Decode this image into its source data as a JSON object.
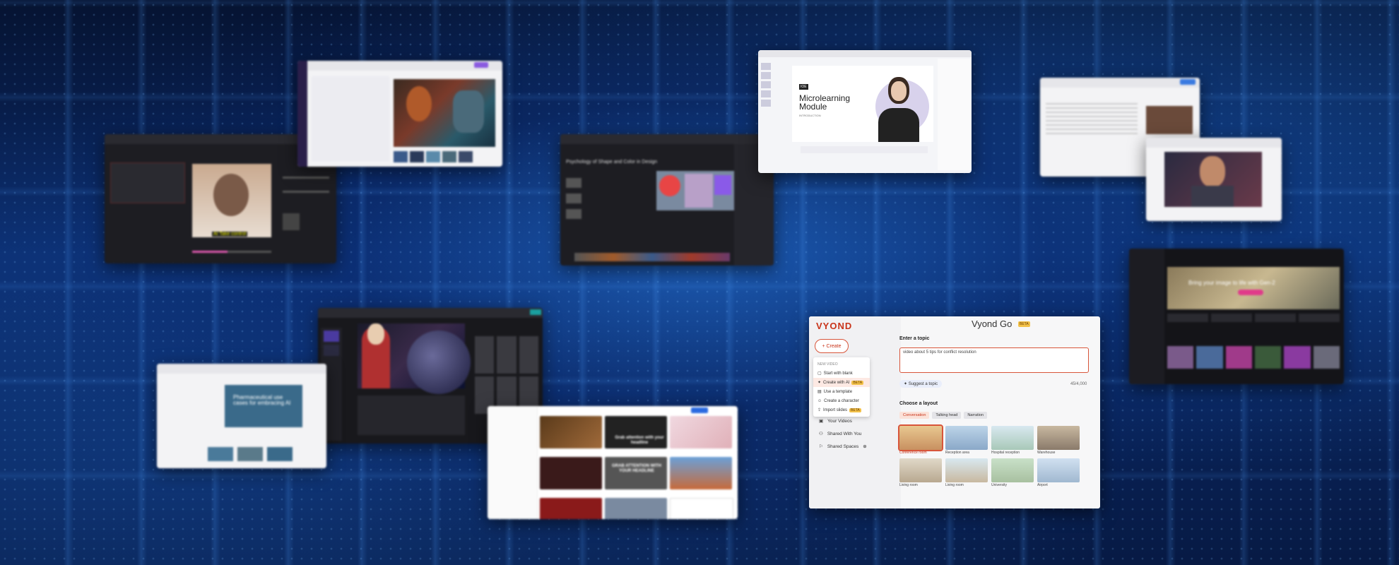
{
  "vyond": {
    "logo": "VYOND",
    "title": "Vyond Go",
    "beta": "BETA",
    "create_button": "+ Create",
    "menu_header": "NEW VIDEO",
    "menu_items": [
      {
        "label": "Start with blank",
        "badge": ""
      },
      {
        "label": "Create with AI",
        "badge": "BETA"
      },
      {
        "label": "Use a template",
        "badge": ""
      },
      {
        "label": "Create a character",
        "badge": ""
      },
      {
        "label": "Import slides",
        "badge": "BETA"
      }
    ],
    "nav": [
      "Your Videos",
      "Shared With You",
      "Shared Spaces"
    ],
    "topic_label": "Enter a topic",
    "topic_value": "video about 5 tips for conflict resolution",
    "suggest": "Suggest a topic",
    "char_count": "45/4,000",
    "layout_label": "Choose a layout",
    "layout_tabs": [
      "Conversation",
      "Talking head",
      "Narration"
    ],
    "layouts": [
      "Conference room",
      "Reception area",
      "Hospital reception",
      "Warehouse",
      "Living room",
      "Living room",
      "University",
      "Airport"
    ]
  },
  "micro": {
    "tag": "IOE",
    "title": "Microlearning Module",
    "subtitle": "INTRODUCTION"
  },
  "stock": {
    "tile_texts": [
      "Grab attention with your headline",
      "GRAB ATTENTION WITH YOUR HEADLINE",
      "Grab attention"
    ]
  },
  "pharma": {
    "title": "Pharmaceutical use cases for embracing AI"
  },
  "sora": {
    "banner": "Bring your image to life with Gen-2"
  },
  "left_win": {
    "caption": "AI Take control"
  },
  "dark_mid": {
    "title": "Psychology of Shape and Color in Design"
  },
  "colors": {
    "vyond_accent": "#d8553a",
    "vyond_logo": "#c9341a",
    "beta_badge": "#f3c24a",
    "background_blue": "#0a2a6a"
  }
}
